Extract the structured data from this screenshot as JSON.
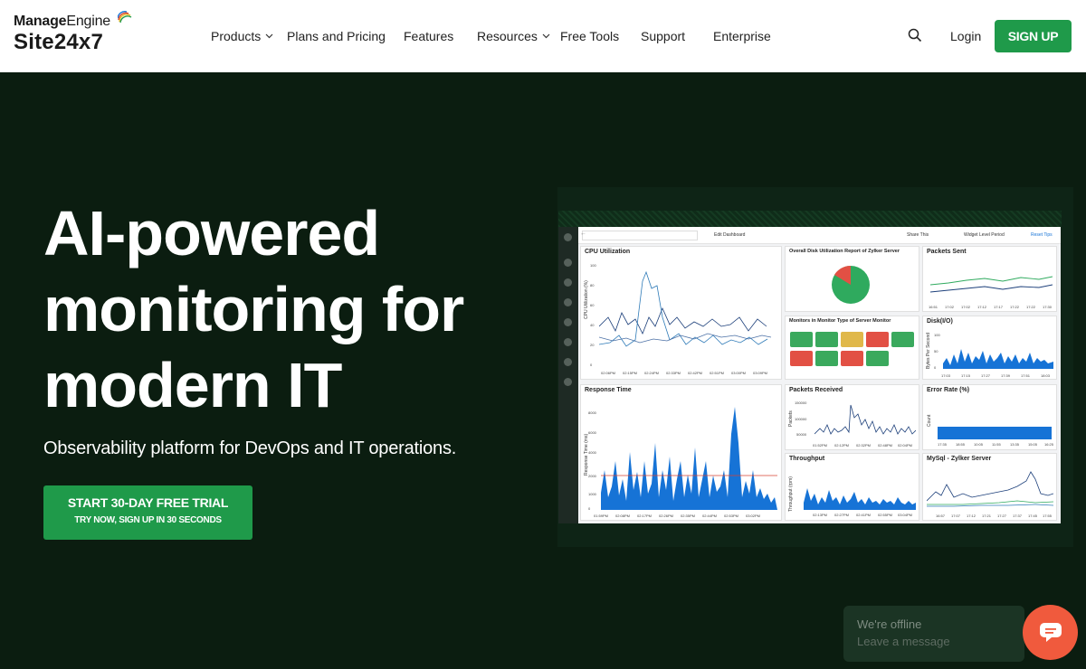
{
  "brand": {
    "top_bold": "Manage",
    "top_regular": "Engine",
    "product": "Site24x7"
  },
  "nav": {
    "items": [
      {
        "label": "Products",
        "dropdown": true
      },
      {
        "label": "Plans and Pricing",
        "dropdown": false
      },
      {
        "label": "Features",
        "dropdown": false
      },
      {
        "label": "Resources",
        "dropdown": true
      },
      {
        "label": "Free Tools",
        "dropdown": false
      },
      {
        "label": "Support",
        "dropdown": false
      },
      {
        "label": "Enterprise",
        "dropdown": false
      }
    ],
    "search_icon": "search-icon",
    "login_label": "Login",
    "signup_label": "SIGN UP"
  },
  "hero": {
    "title_line1": "AI-powered",
    "title_line2": "monitoring for",
    "title_line3": "modern IT",
    "subtitle": "Observability platform for DevOps and IT operations.",
    "cta_main": "START 30-DAY FREE TRIAL",
    "cta_sub": "TRY NOW, SIGN UP IN 30 SECONDS"
  },
  "dashboard": {
    "toolbar": {
      "edit": "Edit Dashboard",
      "share": "Share This",
      "period": "Widget Level Period",
      "reset": "Reset Tips"
    },
    "widgets": {
      "cpu": {
        "title": "CPU Utilization",
        "ylabel": "CPU Utilization (%)",
        "yticks": [
          "100",
          "80",
          "60",
          "40",
          "20",
          "0"
        ],
        "xticks": [
          "02:06PM",
          "02:15PM",
          "02:24PM",
          "02:33PM",
          "02:42PM",
          "02:51PM",
          "03:00PM",
          "03:09PM"
        ]
      },
      "disk": {
        "title": "Overall Disk Utilization Report of Zylker Server"
      },
      "packets_sent": {
        "title": "Packets Sent",
        "xticks": [
          "16:51",
          "17:02",
          "17:02",
          "17:12",
          "17:17",
          "17:22",
          "17:22",
          "17:30"
        ]
      },
      "monitors": {
        "title": "Monitors in Monitor Type of Server Monitor"
      },
      "disk_io": {
        "title": "Disk(I/O)",
        "ylabel": "Bytes Per Second",
        "yticks": [
          "100",
          "50",
          "0"
        ],
        "xticks": [
          "17:03",
          "17:15",
          "17:27",
          "17:39",
          "17:51",
          "18:03"
        ]
      },
      "response": {
        "title": "Response Time",
        "ylabel": "Response Time (ms)",
        "yticks": [
          "8000",
          "6000",
          "4000",
          "2000",
          "1000",
          "0"
        ],
        "xticks": [
          "01:59PM",
          "02:08PM",
          "02:17PM",
          "02:26PM",
          "02:35PM",
          "02:44PM",
          "02:53PM",
          "03:02PM"
        ]
      },
      "packets_received": {
        "title": "Packets Received",
        "ylabel": "Packets",
        "yticks": [
          "150000",
          "100000",
          "50000"
        ],
        "xticks": [
          "01:52PM",
          "02:12PM",
          "02:32PM",
          "02:48PM",
          "02:04PM"
        ]
      },
      "error_rate": {
        "title": "Error Rate (%)",
        "ylabel": "Count",
        "xticks": [
          "17:35",
          "18:55",
          "10:05",
          "11:55",
          "13:35",
          "15:05",
          "16:25"
        ]
      },
      "throughput": {
        "title": "Throughput",
        "ylabel": "Throughput (rpm)",
        "xticks": [
          "02:13PM",
          "02:27PM",
          "02:41PM",
          "02:55PM",
          "03:04PM"
        ]
      },
      "mysql": {
        "title": "MySql - Zylker Server",
        "xticks": [
          "16:57",
          "17:07",
          "17:12",
          "17:21",
          "17:27",
          "17:37",
          "17:45",
          "17:55"
        ]
      }
    },
    "monitor_colors": [
      "#3aa95d",
      "#3aa95d",
      "#e0b84a",
      "#e25044",
      "#3aa95d",
      "#e25044",
      "#3aa95d",
      "#e25044",
      "#3aa95d"
    ],
    "chart_color": "#1673d6"
  },
  "chat": {
    "status": "We're offline",
    "message": "Leave a message",
    "icon": "chat-bubble-icon"
  }
}
